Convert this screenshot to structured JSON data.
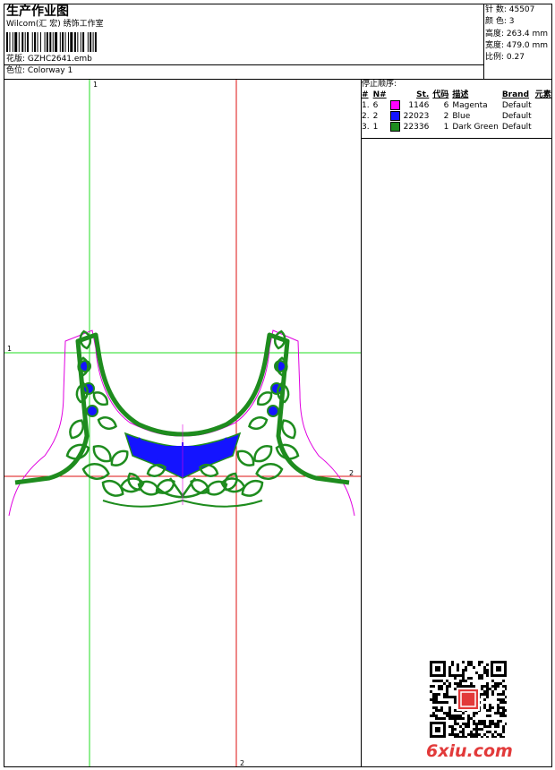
{
  "header": {
    "title": "生产作业图",
    "studio": "Wilcom(汇 宏) 绣饰工作室",
    "design_label": "花版:",
    "design_name": "GZHC2641.emb",
    "colorway_label": "色位:",
    "colorway_name": "Colorway 1"
  },
  "stats": {
    "stitches": "针 数: 45507",
    "colors": "颜 色: 3",
    "height": "高度: 263.4 mm",
    "width": "宽度: 479.0 mm",
    "scale": "比例: 0.27"
  },
  "stop_sequence": {
    "title": "停止顺序:",
    "headers": [
      "#",
      "N#",
      "St.",
      "代码",
      "描述",
      "Brand",
      "元素"
    ],
    "rows": [
      {
        "idx": "1.",
        "n": "6",
        "color": "#ff00ff",
        "st": "1146",
        "code": "6",
        "desc": "Magenta",
        "brand": "Default"
      },
      {
        "idx": "2.",
        "n": "2",
        "color": "#1414ff",
        "st": "22023",
        "code": "2",
        "desc": "Blue",
        "brand": "Default"
      },
      {
        "idx": "3.",
        "n": "1",
        "color": "#1e8c1e",
        "st": "22336",
        "code": "1",
        "desc": "Dark Green",
        "brand": "Default"
      }
    ]
  },
  "guides": {
    "v1": "1",
    "v2": "2",
    "h1": "1",
    "h2": "2"
  },
  "colors": {
    "magenta": "#e000e0",
    "blue": "#1414ff",
    "green": "#1e8c1e",
    "guide_green": "#22dd22",
    "guide_red": "#dd1111"
  },
  "watermark": "6xiu.com"
}
